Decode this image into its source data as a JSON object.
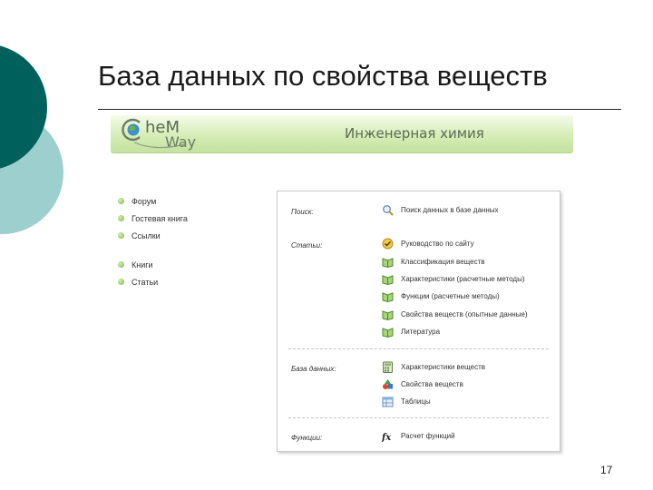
{
  "slide": {
    "title": "База данных по свойства веществ",
    "page_number": "17"
  },
  "site": {
    "logo_line1": "heM",
    "logo_line2": "Way",
    "banner_title": "Инженерная химия"
  },
  "nav": {
    "items": [
      {
        "label": "Форум"
      },
      {
        "label": "Гостевая книга"
      },
      {
        "label": "Ссылки"
      },
      {
        "label": "Книги"
      },
      {
        "label": "Статьи"
      }
    ]
  },
  "panel": {
    "search": {
      "label": "Поиск:",
      "links": [
        {
          "label": "Поиск данных в базе данных",
          "icon": "search-icon"
        }
      ]
    },
    "articles": {
      "label": "Статьи:",
      "links": [
        {
          "label": "Руководство по сайту",
          "icon": "guide-icon"
        },
        {
          "label": "Классификация веществ",
          "icon": "book-icon"
        },
        {
          "label": "Характеристики (расчетные методы)",
          "icon": "book-icon"
        },
        {
          "label": "Функции (расчетные методы)",
          "icon": "book-icon"
        },
        {
          "label": "Свойства веществ (опытные данные)",
          "icon": "book-icon"
        },
        {
          "label": "Литература",
          "icon": "book-icon"
        }
      ]
    },
    "database": {
      "label": "База данных:",
      "links": [
        {
          "label": "Характеристики веществ",
          "icon": "calculator-icon"
        },
        {
          "label": "Свойства веществ",
          "icon": "shapes-icon"
        },
        {
          "label": "Таблицы",
          "icon": "table-icon"
        }
      ]
    },
    "functions": {
      "label": "Функции:",
      "links": [
        {
          "label": "Расчет функций",
          "icon": "function-icon"
        }
      ]
    }
  },
  "colors": {
    "deco_dark": "#00605c",
    "deco_light": "#9dcfcf",
    "banner_green": "#cfe8ad",
    "bullet_green": "#7fb04a"
  }
}
